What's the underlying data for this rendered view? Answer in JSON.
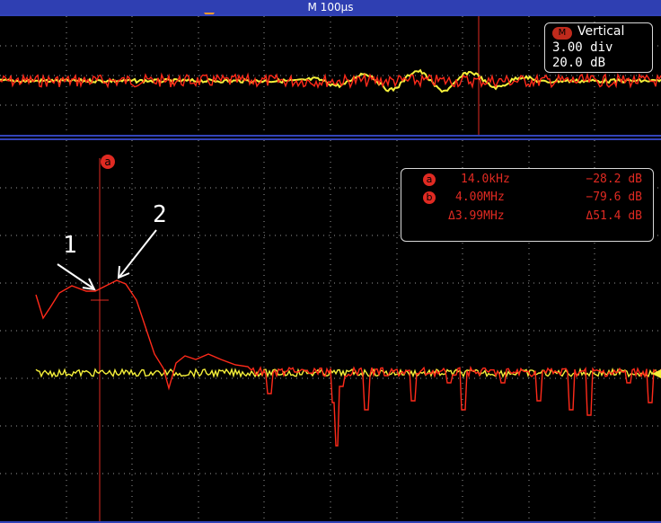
{
  "header": {
    "timebase": "M 100µs"
  },
  "vertical_box": {
    "badge": "M",
    "title": "Vertical",
    "scale": "3.00 div",
    "offset": "20.0 dB"
  },
  "cursors": {
    "a_badge": "a",
    "b_badge": "b",
    "a_freq": "14.0kHz",
    "a_level": "−28.2 dB",
    "b_freq": "4.00MHz",
    "b_level": "−79.6 dB",
    "delta_freq": "Δ3.99MHz",
    "delta_level": "Δ51.4 dB"
  },
  "annotations": {
    "label_1": "1",
    "label_2": "2"
  },
  "colors": {
    "ref_trace": "#ff2a1a",
    "live_trace": "#f5f03a",
    "frame": "#3243b8",
    "header": "#2f3fb2",
    "cursor": "#e02a22"
  }
}
